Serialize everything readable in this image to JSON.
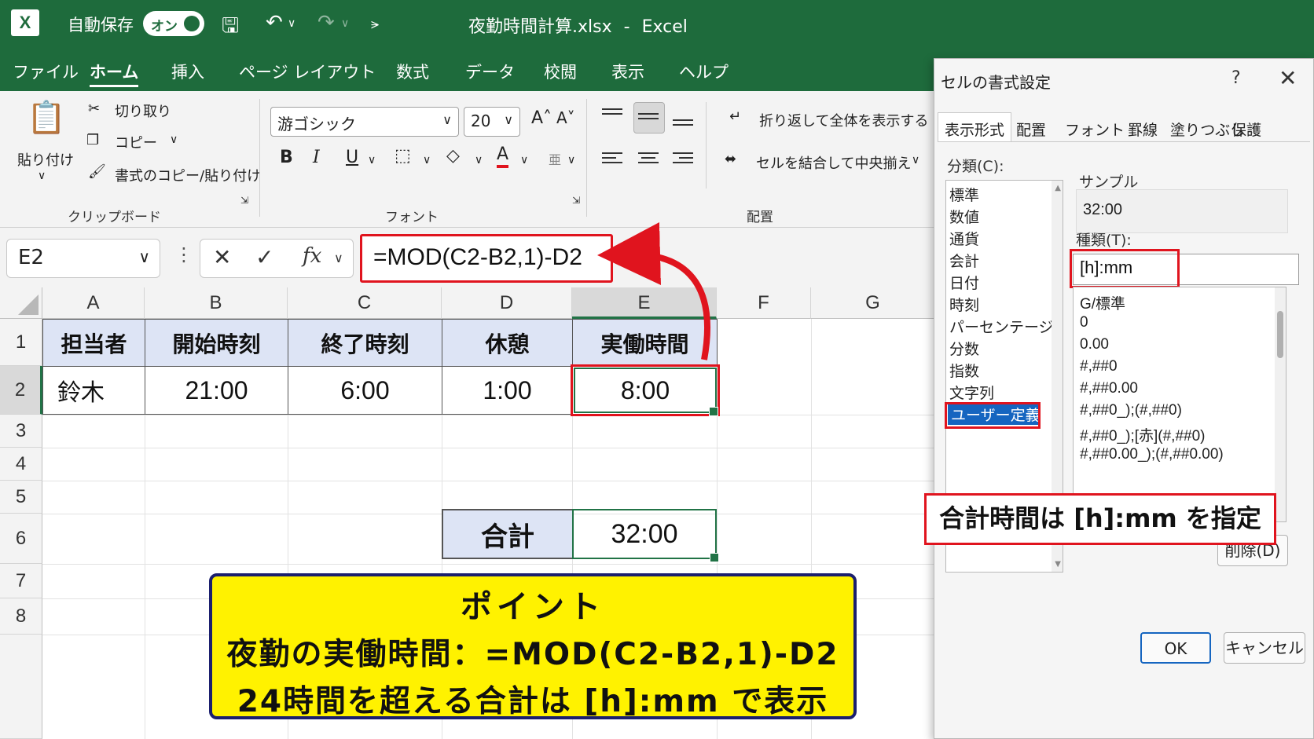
{
  "titlebar": {
    "logo": "X",
    "autosave_label": "自動保存",
    "autosave_toggle": "オン",
    "filename": "夜勤時間計算.xlsx",
    "separator": "-",
    "app_name": "Excel"
  },
  "tabs": [
    "ファイル",
    "ホーム",
    "挿入",
    "ページ レイアウト",
    "数式",
    "データ",
    "校閲",
    "表示",
    "ヘルプ"
  ],
  "ribbon": {
    "paste": "貼り付け",
    "cut": "切り取り",
    "copy": "コピー",
    "format_painter": "書式のコピー/貼り付け",
    "clipboard_group": "クリップボード",
    "font_name": "游ゴシック",
    "font_size": "20",
    "font_group": "フォント",
    "bold": "B",
    "italic": "I",
    "underline": "U",
    "wrap_text": "折り返して全体を表示する",
    "merge_center": "セルを結合して中央揃え",
    "alignment_group": "配置"
  },
  "formula_bar": {
    "name_box": "E2",
    "fx": "fx",
    "formula": "=MOD(C2-B2,1)-D2"
  },
  "sheet": {
    "columns": [
      "A",
      "B",
      "C",
      "D",
      "E",
      "F",
      "G"
    ],
    "rows": [
      "1",
      "2",
      "3",
      "4",
      "5",
      "6",
      "7",
      "8"
    ],
    "headers": [
      "担当者",
      "開始時刻",
      "終了時刻",
      "休憩",
      "実働時間"
    ],
    "row2": [
      "鈴木",
      "21:00",
      "6:00",
      "1:00",
      "8:00"
    ],
    "total_label": "合計",
    "total_value": "32:00"
  },
  "point_box": {
    "title": "ポイント",
    "line1": "夜勤の実働時間：=MOD(C2-B2,1)-D2",
    "line2": "24時間を超える合計は [h]:mm で表示"
  },
  "dialog": {
    "title": "セルの書式設定",
    "help": "?",
    "close": "X",
    "tabs": [
      "表示形式",
      "配置",
      "フォント",
      "罫線",
      "塗りつぶし",
      "保護"
    ],
    "category_label": "分類(C):",
    "categories": [
      "標準",
      "数値",
      "通貨",
      "会計",
      "日付",
      "時刻",
      "パーセンテージ",
      "分数",
      "指数",
      "文字列",
      "ユーザー定義"
    ],
    "selected_category": "ユーザー定義",
    "sample_label": "サンプル",
    "sample_value": "32:00",
    "type_label": "種類(T):",
    "type_value": "[h]:mm",
    "formats": [
      "G/標準",
      "0",
      "0.00",
      "#,##0",
      "#,##0.00",
      "#,##0_);(#,##0)",
      "#,##0_);[赤](#,##0)",
      "#,##0.00_);(#,##0.00)"
    ],
    "delete_button": "削除(D)",
    "ok_button": "OK",
    "cancel_button": "キャンセル"
  },
  "callout": "合計時間は [h]:mm を指定",
  "colors": {
    "excel_green": "#1e6b3c",
    "highlight_red": "#e0141e",
    "header_fill": "#dde4f5",
    "point_yellow": "#fff200",
    "selection_blue": "#1565c0"
  }
}
